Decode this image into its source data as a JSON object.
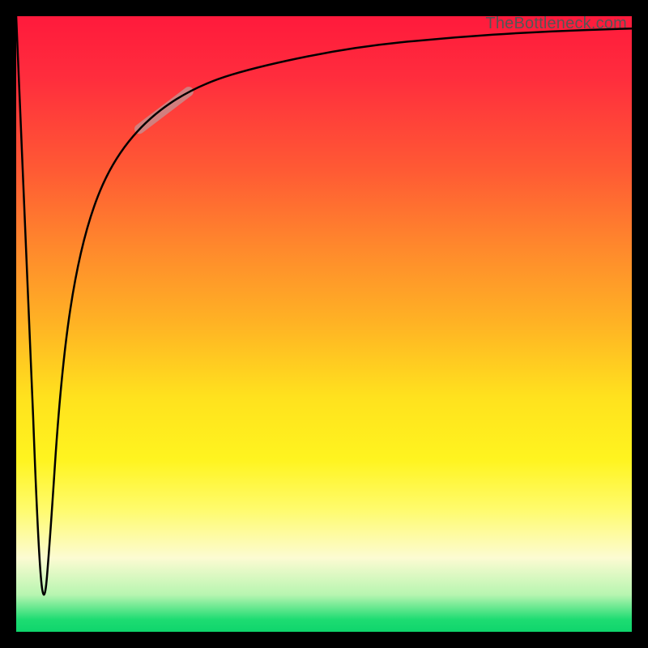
{
  "attribution": "TheBottleneck.com",
  "chart_data": {
    "type": "line",
    "title": "",
    "xlabel": "",
    "ylabel": "",
    "xlim": [
      0,
      100
    ],
    "ylim": [
      0,
      100
    ],
    "grid": false,
    "legend": false,
    "series": [
      {
        "name": "bottleneck-curve",
        "x": [
          0,
          2,
          3.5,
          4.5,
          5.5,
          7,
          9,
          12,
          16,
          22,
          30,
          40,
          55,
          70,
          85,
          100
        ],
        "y": [
          100,
          55,
          15,
          3,
          15,
          38,
          55,
          68,
          77,
          84,
          89,
          92,
          95,
          96.5,
          97.5,
          98
        ]
      }
    ],
    "highlight_segment": {
      "on_series": "bottleneck-curve",
      "x_start": 20,
      "x_end": 28,
      "note": "faded thick overlay segment on rising branch"
    },
    "background_gradient": {
      "direction": "vertical",
      "stops": [
        {
          "y": 100,
          "color": "#ff1a3c"
        },
        {
          "y": 50,
          "color": "#ffb324"
        },
        {
          "y": 25,
          "color": "#fff41f"
        },
        {
          "y": 5,
          "color": "#b7f5b0"
        },
        {
          "y": 0,
          "color": "#0fd56c"
        }
      ]
    }
  }
}
